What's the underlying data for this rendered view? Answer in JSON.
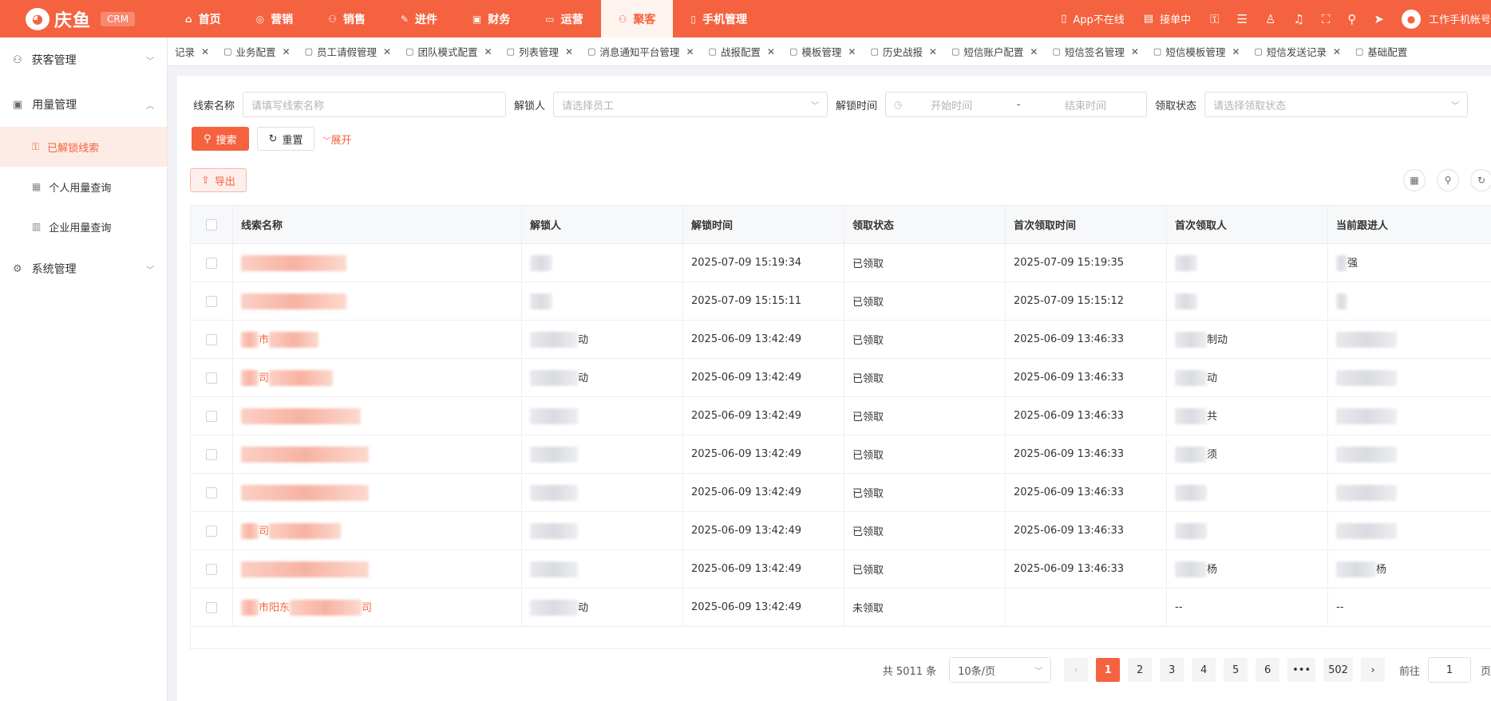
{
  "brand": {
    "logo": "庆鱼",
    "badge": "CRM"
  },
  "nav": [
    {
      "label": "首页",
      "icon": "home-icon"
    },
    {
      "label": "营销",
      "icon": "marketing-icon"
    },
    {
      "label": "销售",
      "icon": "sales-icon"
    },
    {
      "label": "进件",
      "icon": "form-icon"
    },
    {
      "label": "财务",
      "icon": "finance-icon"
    },
    {
      "label": "运营",
      "icon": "monitor-icon"
    },
    {
      "label": "聚客",
      "icon": "users-icon",
      "active": true
    },
    {
      "label": "手机管理",
      "icon": "phone-icon"
    }
  ],
  "topright": {
    "app_status": "App不在线",
    "order_status": "接单中",
    "account": "工作手机帐号"
  },
  "sidebar": {
    "groups": [
      {
        "label": "获客管理",
        "icon": "user-icon",
        "expanded": false
      },
      {
        "label": "用量管理",
        "icon": "chart-icon",
        "expanded": true,
        "items": [
          {
            "label": "已解锁线索",
            "icon": "lock-icon",
            "active": true
          },
          {
            "label": "个人用量查询",
            "icon": "badge-icon"
          },
          {
            "label": "企业用量查询",
            "icon": "building-icon"
          }
        ]
      },
      {
        "label": "系统管理",
        "icon": "settings-icon",
        "expanded": false
      }
    ]
  },
  "tabs": [
    "记录",
    "业务配置",
    "员工请假管理",
    "团队模式配置",
    "列表管理",
    "消息通知平台管理",
    "战报配置",
    "模板管理",
    "历史战报",
    "短信账户配置",
    "短信签名管理",
    "短信模板管理",
    "短信发送记录",
    "基础配置"
  ],
  "filters": {
    "lead_name": {
      "label": "线索名称",
      "placeholder": "请填写线索名称"
    },
    "unlocker": {
      "label": "解锁人",
      "placeholder": "请选择员工"
    },
    "unlock_time": {
      "label": "解锁时间",
      "start": "开始时间",
      "sep": "-",
      "end": "结束时间"
    },
    "claim_status": {
      "label": "领取状态",
      "placeholder": "请选择领取状态"
    }
  },
  "buttons": {
    "search": "搜索",
    "reset": "重置",
    "expand": "展开",
    "export": "导出"
  },
  "table": {
    "headers": [
      "线索名称",
      "解锁人",
      "解锁时间",
      "领取状态",
      "首次领取时间",
      "首次领取人",
      "当前跟进人"
    ],
    "rows": [
      {
        "unlock_time": "2025-07-09 15:19:34",
        "status": "已领取",
        "first_claim": "2025-07-09 15:19:35",
        "follow_text": "强"
      },
      {
        "unlock_time": "2025-07-09 15:15:11",
        "status": "已领取",
        "first_claim": "2025-07-09 15:15:12"
      },
      {
        "lead_text": "市",
        "unlocker_text": "动",
        "unlock_time": "2025-06-09 13:42:49",
        "status": "已领取",
        "first_claim": "2025-06-09 13:46:33",
        "claimer_text": "制动"
      },
      {
        "lead_text": "司",
        "unlocker_text": "动",
        "unlock_time": "2025-06-09 13:42:49",
        "status": "已领取",
        "first_claim": "2025-06-09 13:46:33",
        "claimer_text": "动"
      },
      {
        "unlock_time": "2025-06-09 13:42:49",
        "status": "已领取",
        "first_claim": "2025-06-09 13:46:33",
        "claimer_text": "共"
      },
      {
        "unlock_time": "2025-06-09 13:42:49",
        "status": "已领取",
        "first_claim": "2025-06-09 13:46:33",
        "claimer_text": "须"
      },
      {
        "unlock_time": "2025-06-09 13:42:49",
        "status": "已领取",
        "first_claim": "2025-06-09 13:46:33"
      },
      {
        "lead_text": "司",
        "unlock_time": "2025-06-09 13:42:49",
        "status": "已领取",
        "first_claim": "2025-06-09 13:46:33"
      },
      {
        "unlock_time": "2025-06-09 13:42:49",
        "status": "已领取",
        "first_claim": "2025-06-09 13:46:33",
        "claimer_text": "杨",
        "follow_text": "杨"
      },
      {
        "lead_text": "市阳东",
        "lead_suffix": "司",
        "unlocker_text": "动",
        "unlock_time": "2025-06-09 13:42:49",
        "status": "未领取",
        "first_claim": "",
        "claimer_text": "--",
        "follow_text": "--"
      }
    ]
  },
  "pagination": {
    "total": "共 5011 条",
    "page_size": "10条/页",
    "pages": [
      "1",
      "2",
      "3",
      "4",
      "5",
      "6",
      "•••",
      "502"
    ],
    "active": "1",
    "goto_label": "前往",
    "goto_value": "1",
    "page_suffix": "页"
  },
  "colors": {
    "accent": "#f5623f"
  }
}
